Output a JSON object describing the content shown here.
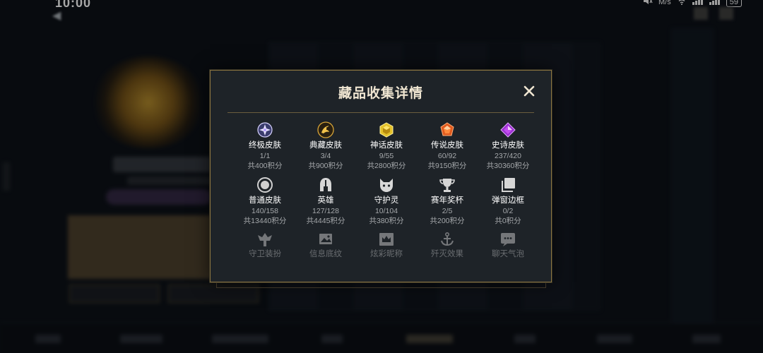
{
  "status_bar": {
    "time": "10:00",
    "network_speed": "M/s",
    "battery": "59"
  },
  "modal": {
    "title": "藏品收集详情",
    "close_icon": "close-icon",
    "accent_color": "#8c7540",
    "categories": [
      {
        "name": "终极皮肤",
        "count": "1/1",
        "points": "共400积分",
        "icon": "ultimate-skin-icon"
      },
      {
        "name": "典藏皮肤",
        "count": "3/4",
        "points": "共900积分",
        "icon": "mythic-dragon-skin-icon"
      },
      {
        "name": "神话皮肤",
        "count": "9/55",
        "points": "共2800积分",
        "icon": "mythic-skin-icon"
      },
      {
        "name": "传说皮肤",
        "count": "60/92",
        "points": "共9150积分",
        "icon": "legendary-skin-icon"
      },
      {
        "name": "史诗皮肤",
        "count": "237/420",
        "points": "共30360积分",
        "icon": "epic-skin-icon"
      },
      {
        "name": "普通皮肤",
        "count": "140/158",
        "points": "共13440积分",
        "icon": "standard-skin-icon"
      },
      {
        "name": "英雄",
        "count": "127/128",
        "points": "共4445积分",
        "icon": "champion-helmet-icon"
      },
      {
        "name": "守护灵",
        "count": "10/104",
        "points": "共380积分",
        "icon": "little-legend-icon"
      },
      {
        "name": "赛年奖杯",
        "count": "2/5",
        "points": "共200积分",
        "icon": "trophy-icon"
      },
      {
        "name": "弹窗边框",
        "count": "0/2",
        "points": "共0积分",
        "icon": "frame-icon"
      },
      {
        "name": "守卫装扮",
        "icon": "ward-skin-icon"
      },
      {
        "name": "信息底纹",
        "icon": "banner-icon"
      },
      {
        "name": "炫彩昵称",
        "icon": "crown-icon"
      },
      {
        "name": "歼灭效果",
        "icon": "anchor-icon"
      },
      {
        "name": "聊天气泡",
        "icon": "chat-bubble-icon"
      }
    ]
  }
}
